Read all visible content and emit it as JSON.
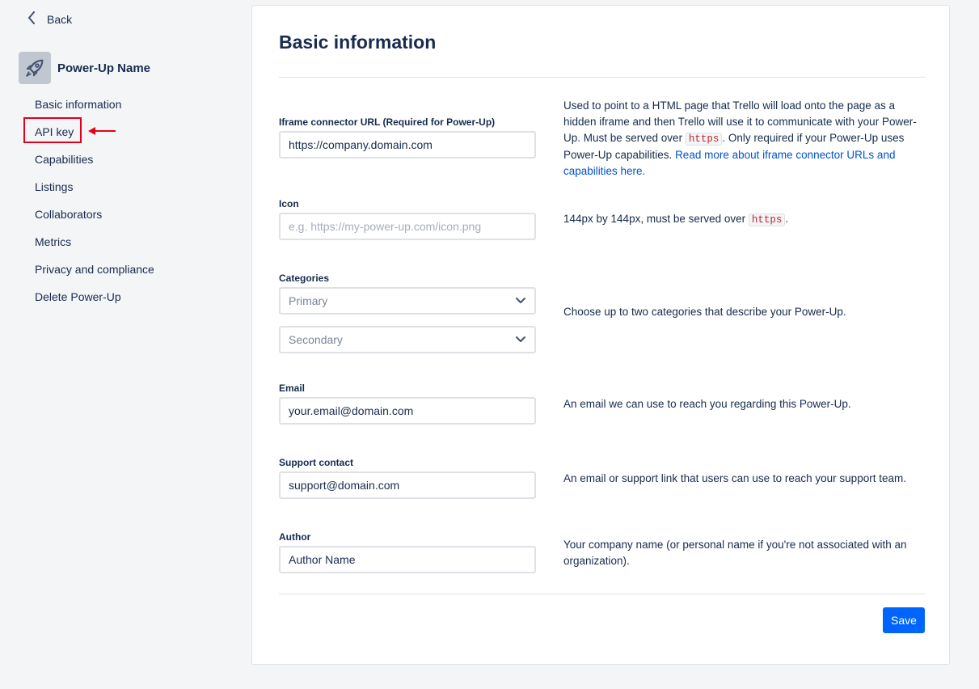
{
  "sidebar": {
    "back_label": "Back",
    "powerup_name": "Power-Up Name",
    "items": [
      {
        "label": "Basic information"
      },
      {
        "label": "API key"
      },
      {
        "label": "Capabilities"
      },
      {
        "label": "Listings"
      },
      {
        "label": "Collaborators"
      },
      {
        "label": "Metrics"
      },
      {
        "label": "Privacy and compliance"
      },
      {
        "label": "Delete Power-Up"
      }
    ]
  },
  "main": {
    "title": "Basic information",
    "iframe": {
      "label": "Iframe connector URL (Required for Power-Up)",
      "value": "https://company.domain.com",
      "help_1": "Used to point to a HTML page that Trello will load onto the page as a hidden iframe and then Trello will use it to communicate with your Power-Up. Must be served over ",
      "help_code": "https",
      "help_2": ". Only required if your Power-Up uses Power-Up capabilities. ",
      "help_link": "Read more about iframe connector URLs and capabilities here."
    },
    "icon": {
      "label": "Icon",
      "placeholder": "e.g. https://my-power-up.com/icon.png",
      "help_1": "144px by 144px, must be served over ",
      "help_code": "https",
      "help_2": "."
    },
    "categories": {
      "label": "Categories",
      "primary_placeholder": "Primary",
      "secondary_placeholder": "Secondary",
      "help": "Choose up to two categories that describe your Power-Up."
    },
    "email": {
      "label": "Email",
      "value": "your.email@domain.com",
      "help": "An email we can use to reach you regarding this Power-Up."
    },
    "support": {
      "label": "Support contact",
      "value": "support@domain.com",
      "help": "An email or support link that users can use to reach your support team."
    },
    "author": {
      "label": "Author",
      "value": "Author Name",
      "help": "Your company name (or personal name if you're not associated with an organization)."
    },
    "save_label": "Save"
  },
  "icons": {
    "back": "chevron-left-icon",
    "powerup": "rocket-icon",
    "dropdown": "chevron-down-icon",
    "annotation": "red-arrow-icon"
  },
  "colors": {
    "accent": "#0065ff",
    "link": "#0052cc",
    "annotation": "#e3001b",
    "code": "#c1272d"
  }
}
